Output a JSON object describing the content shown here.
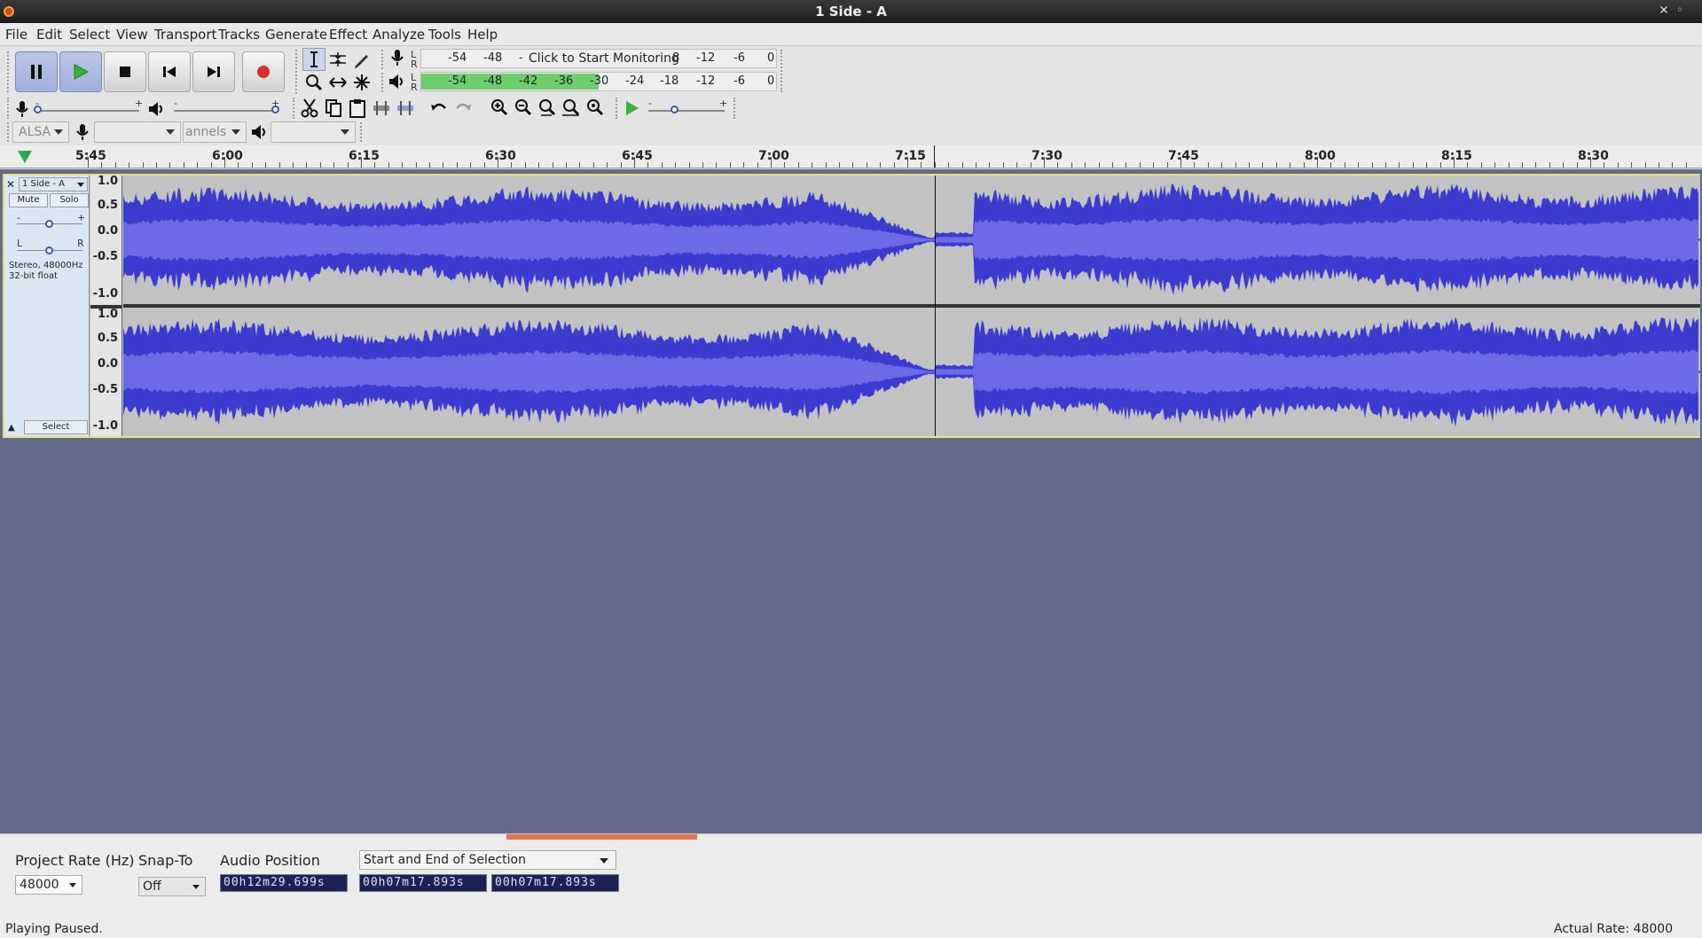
{
  "window": {
    "title": "1 Side - A",
    "controls": [
      "✕",
      "◦"
    ]
  },
  "menu": [
    "File",
    "Edit",
    "Select",
    "View",
    "Transport",
    "Tracks",
    "Generate",
    "Effect",
    "Analyze",
    "Tools",
    "Help"
  ],
  "meters": {
    "record": {
      "lr": [
        "L",
        "R"
      ],
      "ticks": [
        "-54",
        "-48"
      ],
      "monitor_text": "Click to Start Monitoring",
      "tail_ticks": [
        "8",
        "-12",
        "-6",
        "0"
      ]
    },
    "playback": {
      "lr": [
        "L",
        "R"
      ],
      "ticks": [
        "-54",
        "-48",
        "-42",
        "-36",
        "-30",
        "-24",
        "-18",
        "-12",
        "-6",
        "0"
      ],
      "level_db": -30
    }
  },
  "mixer": {
    "minus": "-",
    "plus": "+"
  },
  "play_at_speed": {
    "minus": "-",
    "plus": "+"
  },
  "device": {
    "host": "ALSA",
    "record_device": "",
    "channels": "annels",
    "playback_device": ""
  },
  "timeline": {
    "labels": [
      "5:45",
      "6:00",
      "6:15",
      "6:30",
      "6:45",
      "7:00",
      "7:15",
      "7:30",
      "7:45",
      "8:00",
      "8:15",
      "8:30"
    ]
  },
  "track": {
    "name": "1 Side - A",
    "close": "✕",
    "mute": "Mute",
    "solo": "Solo",
    "gain_minus": "-",
    "gain_plus": "+",
    "pan_left": "L",
    "pan_right": "R",
    "format_rate": "Stereo, 48000Hz",
    "format_bits": "32-bit float",
    "select": "Select",
    "scale": [
      "1.0",
      "0.5",
      "0.0",
      "-0.5",
      "-1.0"
    ]
  },
  "bottom": {
    "project_rate_label": "Project Rate (Hz)",
    "project_rate": "48000",
    "snap_label": "Snap-To",
    "snap_value": "Off",
    "audio_position_label": "Audio Position",
    "audio_position": "00h12m29.699s",
    "selection_mode": "Start and End of Selection",
    "selection_start": "00h07m17.893s",
    "selection_end": "00h07m17.893s"
  },
  "status": {
    "left": "Playing Paused.",
    "right": "Actual Rate: 48000"
  },
  "colors": {
    "waveform": "#3b3bd0",
    "waveform_rms": "#6b6be6",
    "track_bg": "#c2c2c2",
    "workspace": "#636a8a",
    "meter_green": "#6fcf6f"
  }
}
